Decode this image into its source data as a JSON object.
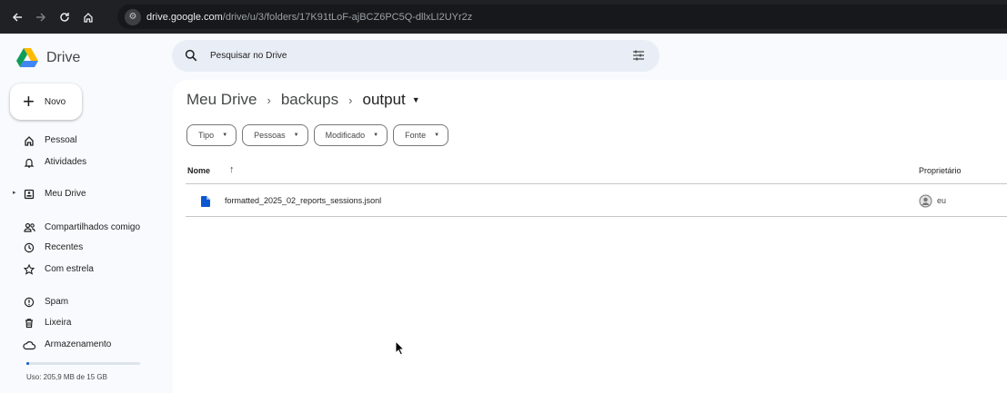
{
  "browser": {
    "url_domain": "drive.google.com",
    "url_path": "/drive/u/3/folders/17K91tLoF-ajBCZ6PC5Q-dllxLI2UYr2z",
    "back_icon": "arrow-left-icon",
    "forward_icon": "arrow-right-icon",
    "reload_icon": "reload-icon",
    "home_icon": "home-icon"
  },
  "app": {
    "name": "Drive"
  },
  "sidebar": {
    "new_label": "Novo",
    "items": [
      {
        "label": "Pessoal",
        "icon": "home-icon"
      },
      {
        "label": "Atividades",
        "icon": "bell-icon"
      },
      {
        "label": "Meu Drive",
        "icon": "drive-icon"
      },
      {
        "label": "Compartilhados comigo",
        "icon": "people-icon"
      },
      {
        "label": "Recentes",
        "icon": "clock-icon"
      },
      {
        "label": "Com estrela",
        "icon": "star-icon"
      },
      {
        "label": "Spam",
        "icon": "spam-icon"
      },
      {
        "label": "Lixeira",
        "icon": "trash-icon"
      },
      {
        "label": "Armazenamento",
        "icon": "cloud-icon"
      }
    ],
    "storage_text": "Uso: 205,9 MB de 15 GB",
    "storage_fraction": 0.013
  },
  "search": {
    "placeholder": "Pesquisar no Drive"
  },
  "breadcrumb": {
    "items": [
      "Meu Drive",
      "backups"
    ],
    "current": "output"
  },
  "filters": [
    "Tipo",
    "Pessoas",
    "Modificado",
    "Fonte"
  ],
  "table": {
    "col_name": "Nome",
    "col_owner": "Proprietário",
    "rows": [
      {
        "name": "formatted_2025_02_reports_sessions.jsonl",
        "owner": "eu"
      }
    ]
  },
  "colors": {
    "accent": "#0b57d0",
    "search_bg": "#e9eef6",
    "page_bg": "#f8fafd",
    "browser_bar": "#202124"
  }
}
